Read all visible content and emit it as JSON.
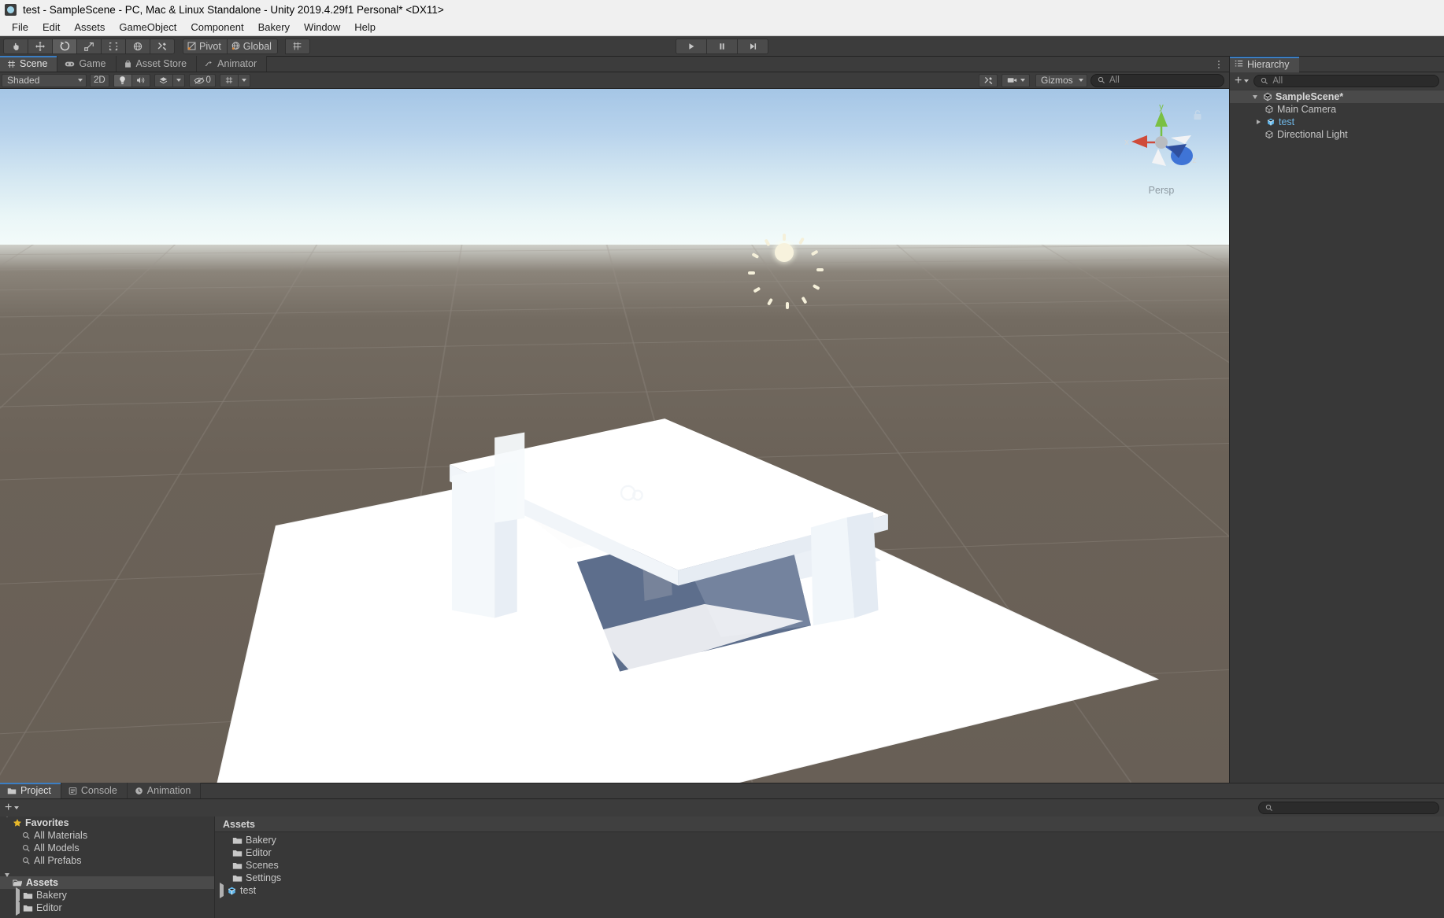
{
  "window": {
    "title": "test - SampleScene - PC, Mac & Linux Standalone - Unity 2019.4.29f1 Personal* <DX11>",
    "app_icon": "unity-icon"
  },
  "menubar": {
    "items": [
      "File",
      "Edit",
      "Assets",
      "GameObject",
      "Component",
      "Bakery",
      "Window",
      "Help"
    ]
  },
  "toolbar": {
    "tools": [
      {
        "name": "hand-tool",
        "icon": "hand-icon",
        "active": false
      },
      {
        "name": "move-tool",
        "icon": "move-icon",
        "active": false
      },
      {
        "name": "rotate-tool",
        "icon": "rotate-icon",
        "active": true
      },
      {
        "name": "scale-tool",
        "icon": "scale-icon",
        "active": false
      },
      {
        "name": "rect-tool",
        "icon": "rect-icon",
        "active": false
      },
      {
        "name": "transform-tool",
        "icon": "transform-icon",
        "active": false
      },
      {
        "name": "custom-tool",
        "icon": "wrench-icon",
        "active": false
      }
    ],
    "pivot_label": "Pivot",
    "global_label": "Global",
    "grid_snap": "grid-snap-icon",
    "play_label": "play-icon",
    "pause_label": "pause-icon",
    "step_label": "step-icon"
  },
  "view_tabs": [
    {
      "label": "Scene",
      "icon": "grid-icon",
      "active": true
    },
    {
      "label": "Game",
      "icon": "gamepad-icon",
      "active": false
    },
    {
      "label": "Asset Store",
      "icon": "store-icon",
      "active": false
    },
    {
      "label": "Animator",
      "icon": "animator-icon",
      "active": false
    }
  ],
  "scene_toolbar": {
    "draw_mode": "Shaded",
    "mode_2d": "2D",
    "lighting_icon": "lightbulb-icon",
    "audio_icon": "speaker-icon",
    "fx_icon": "effects-icon",
    "fx_caret": "chevron-down-icon",
    "visibility_icon": "eye-off-icon",
    "visibility_count": "0",
    "grid_icon": "scene-grid-icon",
    "grid_caret": "chevron-down-icon",
    "tools_icon": "wrench-icon",
    "camera_icon": "camera-icon",
    "camera_caret": "chevron-down-icon",
    "gizmos_label": "Gizmos",
    "gizmos_caret": "chevron-down-icon",
    "search_placeholder": "All"
  },
  "scene": {
    "gizmo": {
      "axis_x": "x",
      "axis_y": "y",
      "axis_z": "z",
      "projection": "Persp",
      "lock_icon": "lock-icon"
    },
    "light_gizmo": "directional-light-sun-icon",
    "sky_top_color": "#a5c6e6",
    "horizon_color": "#f3fbfa",
    "ground_color": "#6b6258",
    "object_color": "#ffffff",
    "shadow_color": "#5a6b8a"
  },
  "hierarchy": {
    "tab_label": "Hierarchy",
    "tab_icon": "hierarchy-icon",
    "add_label": "+",
    "add_caret": "chevron-down-icon",
    "search_placeholder": "All",
    "items": [
      {
        "label": "SampleScene*",
        "depth": 0,
        "twisty": "open",
        "icon": "scene-icon",
        "style": "scene",
        "selected": true
      },
      {
        "label": "Main Camera",
        "depth": 1,
        "twisty": "none",
        "icon": "gameobject-icon",
        "style": "normal",
        "selected": false
      },
      {
        "label": "test",
        "depth": 1,
        "twisty": "closed",
        "icon": "prefab-icon",
        "style": "prefab",
        "selected": false
      },
      {
        "label": "Directional Light",
        "depth": 1,
        "twisty": "none",
        "icon": "gameobject-icon",
        "style": "normal",
        "selected": false
      }
    ]
  },
  "project": {
    "tabs": [
      {
        "label": "Project",
        "icon": "folder-icon",
        "active": true
      },
      {
        "label": "Console",
        "icon": "console-icon",
        "active": false
      },
      {
        "label": "Animation",
        "icon": "clock-icon",
        "active": false
      }
    ],
    "add_label": "+",
    "add_caret": "chevron-down-icon",
    "search_placeholder": "",
    "tree": [
      {
        "label": "Favorites",
        "depth": 0,
        "twisty": "open",
        "icon": "star-icon",
        "style": "bold",
        "selected": false
      },
      {
        "label": "All Materials",
        "depth": 1,
        "twisty": "none",
        "icon": "search-icon",
        "style": "normal",
        "selected": false
      },
      {
        "label": "All Models",
        "depth": 1,
        "twisty": "none",
        "icon": "search-icon",
        "style": "normal",
        "selected": false
      },
      {
        "label": "All Prefabs",
        "depth": 1,
        "twisty": "none",
        "icon": "search-icon",
        "style": "normal",
        "selected": false
      },
      {
        "label": "",
        "depth": 0,
        "twisty": "none",
        "icon": "none",
        "style": "gap",
        "selected": false
      },
      {
        "label": "Assets",
        "depth": 0,
        "twisty": "open",
        "icon": "folder-open-icon",
        "style": "bold",
        "selected": true
      },
      {
        "label": "Bakery",
        "depth": 1,
        "twisty": "closed",
        "icon": "folder-icon",
        "style": "normal",
        "selected": false
      },
      {
        "label": "Editor",
        "depth": 1,
        "twisty": "closed",
        "icon": "folder-icon",
        "style": "normal",
        "selected": false
      }
    ],
    "assets_header": "Assets",
    "assets": [
      {
        "label": "Bakery",
        "icon": "folder-icon",
        "twisty": "none",
        "kind": "folder"
      },
      {
        "label": "Editor",
        "icon": "folder-icon",
        "twisty": "none",
        "kind": "folder"
      },
      {
        "label": "Scenes",
        "icon": "folder-icon",
        "twisty": "none",
        "kind": "folder"
      },
      {
        "label": "Settings",
        "icon": "folder-icon",
        "twisty": "none",
        "kind": "folder"
      },
      {
        "label": "test",
        "icon": "prefab-icon",
        "twisty": "closed",
        "kind": "prefab"
      }
    ]
  }
}
